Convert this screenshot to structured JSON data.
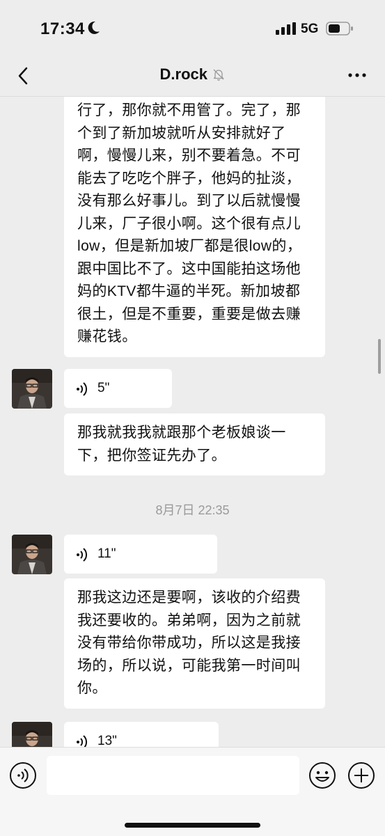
{
  "status_bar": {
    "time": "17:34",
    "network": "5G",
    "icons": [
      "moon-icon",
      "signal-icon",
      "battery-icon"
    ]
  },
  "header": {
    "title": "D.rock",
    "icons": [
      "back-arrow-icon",
      "mute-bell-icon",
      "more-dots-icon"
    ]
  },
  "messages": [
    {
      "type": "text",
      "text": "行了，那你就不用管了。完了，那个到了新加坡就听从安排就好了啊，慢慢儿来，别不要着急。不可能去了吃吃个胖子，他妈的扯淡，没有那么好事儿。到了以后就慢慢儿来，厂子很小啊。这个很有点儿low，但是新加坡厂都是很low的，跟中国比不了。这中国能拍这场他妈的KTV都牛逼的半死。新加坡都很土，但是不重要，重要是做去赚赚花钱。"
    },
    {
      "type": "voice",
      "duration": "5\""
    },
    {
      "type": "text",
      "text": "那我就我我就跟那个老板娘谈一下，把你签证先办了。"
    },
    {
      "type": "timestamp",
      "text": "8月7日 22:35"
    },
    {
      "type": "voice",
      "duration": "11\""
    },
    {
      "type": "text",
      "text": "那我这边还是要啊，该收的介绍费我还要收的。弟弟啊，因为之前就没有带给你带成功，所以这是我接场的，所以说，可能我第一时间叫你。"
    },
    {
      "type": "voice",
      "duration": "13\""
    }
  ],
  "input_bar": {
    "value": "",
    "icons": [
      "voice-input-icon",
      "emoji-icon",
      "plus-icon"
    ]
  },
  "colors": {
    "background": "#ededed",
    "bubble": "#ffffff",
    "timestamp": "#9a9a9a"
  }
}
